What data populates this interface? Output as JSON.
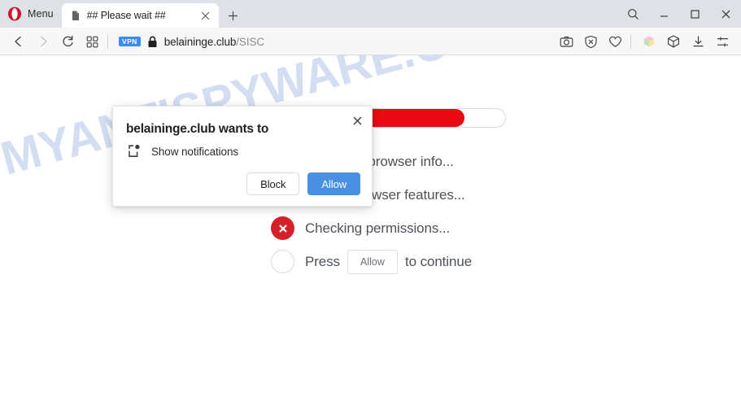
{
  "browser": {
    "name": "Opera",
    "menu_label": "Menu",
    "logo_color": "#d31027",
    "tabs": [
      {
        "title": "## Please wait ##",
        "favicon": "document-icon",
        "active": true
      }
    ],
    "new_tab_label": "+",
    "window_controls": [
      {
        "name": "search-icon",
        "glyph": "search"
      },
      {
        "name": "minimize-icon",
        "glyph": "minimize"
      },
      {
        "name": "maximize-icon",
        "glyph": "maximize"
      },
      {
        "name": "close-icon",
        "glyph": "close"
      }
    ],
    "toolbar": {
      "back": "back-arrow-icon",
      "forward": "forward-arrow-icon",
      "reload": "reload-icon",
      "tab_overview": "tile-grid-icon",
      "vpn_badge": "VPN",
      "lock": "padlock-icon",
      "url_host": "belaininge.club",
      "url_path": "/SISC",
      "right_icons": [
        {
          "name": "snapshot-camera-icon"
        },
        {
          "name": "adblock-shield-icon"
        },
        {
          "name": "heart-favorites-icon"
        },
        {
          "name": "workspaces-cube-icon",
          "accent": "#f1b8cc"
        },
        {
          "name": "player-cube-icon"
        },
        {
          "name": "downloads-icon"
        },
        {
          "name": "easy-setup-sliders-icon"
        }
      ]
    }
  },
  "page": {
    "watermark": "MYANTISPYWARE.COM",
    "watermark_color": "#ccd9f2",
    "progress": {
      "percent": 85,
      "fill_color": "#ea0a13",
      "track_color": "#ffffff"
    },
    "checklist": [
      {
        "state": "done",
        "icon": "check-icon",
        "text": "Analyzing browser info..."
      },
      {
        "state": "done",
        "icon": "check-icon",
        "text": "Testing browser features..."
      },
      {
        "state": "failed",
        "icon": "cross-icon",
        "text": "Checking permissions..."
      },
      {
        "state": "pending",
        "icon": "empty-circle-icon",
        "text_before": "Press",
        "inline_button": "Allow",
        "text_after": "to continue"
      }
    ],
    "status_colors": {
      "done": "#a8dfa8",
      "failed": "#d42026",
      "pending": "#ffffff"
    }
  },
  "permission_dialog": {
    "title": "belaininge.club wants to",
    "permission_icon": "notification-bell-icon",
    "permission_label": "Show notifications",
    "block_label": "Block",
    "allow_label": "Allow",
    "close_icon": "close-icon",
    "allow_color": "#4a90e2"
  }
}
